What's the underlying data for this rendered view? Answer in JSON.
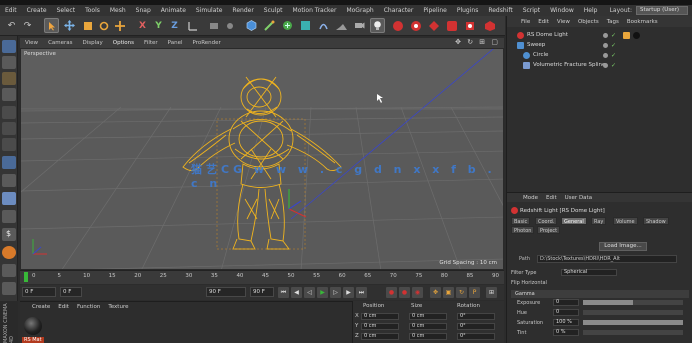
{
  "menubar": {
    "items": [
      "Edit",
      "Create",
      "Select",
      "Tools",
      "Mesh",
      "Snap",
      "Animate",
      "Simulate",
      "Render",
      "Sculpt",
      "Motion Tracker",
      "MoGraph",
      "Character",
      "Pipeline",
      "Plugins",
      "Redshift",
      "Script",
      "Window",
      "Help"
    ],
    "layout_label": "Layout:",
    "layout_value": "Startup (User)"
  },
  "viewport": {
    "menu": [
      "View",
      "Cameras",
      "Display",
      "Options",
      "Filter",
      "Panel",
      "ProRender"
    ],
    "nav_icons": "✥ ↻ ⊞ ▢",
    "label": "Perspective",
    "grid_spacing": "Grid Spacing : 10 cm",
    "watermark": "猫艺CG   w w w . c g d n x x f b . c n"
  },
  "timeline": {
    "labels": [
      "0",
      "5",
      "10",
      "15",
      "20",
      "25",
      "30",
      "35",
      "40",
      "45",
      "50",
      "55",
      "60",
      "65",
      "70",
      "75",
      "80",
      "85",
      "90"
    ],
    "start_frame": "0 F",
    "min_frame": "0 F",
    "max_frame": "90 F",
    "end_frame": "90 F"
  },
  "material_panel": {
    "menu": [
      "Create",
      "Edit",
      "Function",
      "Texture"
    ],
    "material_name": "RS Mat"
  },
  "side_strip": {
    "label": "MAXON CINEMA 4D"
  },
  "coordinates": {
    "headers": [
      "Position",
      "Size",
      "Rotation"
    ],
    "rows": [
      [
        "0 cm",
        "0 cm",
        "0°"
      ],
      [
        "0 cm",
        "0 cm",
        "0°"
      ],
      [
        "0 cm",
        "0 cm",
        "0°"
      ]
    ],
    "axes": [
      "X",
      "Y",
      "Z"
    ]
  },
  "object_manager": {
    "menu": [
      "File",
      "Edit",
      "View",
      "Objects",
      "Tags",
      "Bookmarks"
    ],
    "objects": [
      {
        "name": "RS Dome Light",
        "icon_color": "#d23232",
        "indent": 0
      },
      {
        "name": "Sweep",
        "icon_color": "#4f8fd0",
        "indent": 0
      },
      {
        "name": "Circle",
        "icon_color": "#4f8fd0",
        "indent": 1
      },
      {
        "name": "Volumetric Fracture Spline",
        "icon_color": "#7a9ad0",
        "indent": 1
      }
    ]
  },
  "attribute_manager": {
    "menu": [
      "Mode",
      "Edit",
      "User Data"
    ],
    "title": "Redshift Light [RS Dome Light]",
    "tabs": [
      "Basic",
      "Coord.",
      "General",
      "Ray",
      "Volume",
      "Shadow",
      "Photon",
      "Project"
    ],
    "active_tab": "General",
    "load_button": "Load Image...",
    "path_label": "Path",
    "path_value": "D:\\Stock\\Textures\\HDRI\\HDR_Alt",
    "filter_label": "Filter Type",
    "filter_value": "Spherical",
    "flip_label": "Flip Horizontal",
    "section": "Gamma",
    "params": [
      {
        "label": "Exposure",
        "value": "0",
        "fill": 0.5
      },
      {
        "label": "Hue",
        "value": "0",
        "fill": 0.0
      },
      {
        "label": "Saturation",
        "value": "100 %",
        "fill": 1.0
      },
      {
        "label": "Tint",
        "value": "0 %",
        "fill": 0.0
      }
    ]
  }
}
